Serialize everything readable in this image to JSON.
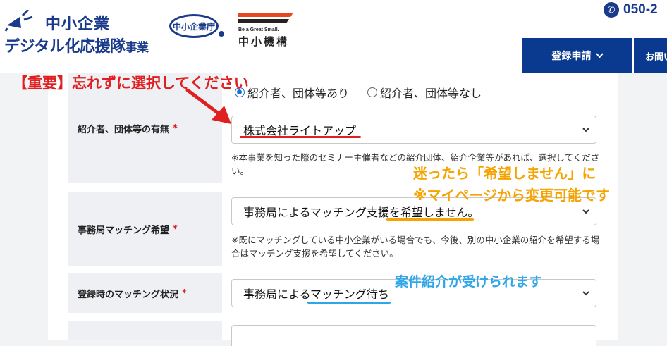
{
  "header": {
    "logo_line1": "中小企業",
    "logo_line2": "デジタル化応援隊",
    "logo_suffix": "事業",
    "agency_logo": "中小企業庁",
    "smrj_tagline": "Be a Great Small.",
    "smrj_name": "中小機構",
    "phone": "050-2",
    "nav_register": "登録申請",
    "nav_contact": "お問い"
  },
  "form": {
    "referrer": {
      "label": "紹介者、団体等の有無",
      "required": "*",
      "radio_yes": "紹介者、団体等あり",
      "radio_no": "紹介者、団体等なし",
      "selected": "株式会社ライトアップ",
      "note": "※本事業を知った際のセミナー主催者などの紹介団体、紹介企業等があれば、選択してください。"
    },
    "matching_request": {
      "label": "事務局マッチング希望",
      "required": "*",
      "selected": "事務局によるマッチング支援を希望しません。",
      "note": "※既にマッチングしている中小企業がいる場合でも、今後、別の中小企業の紹介を希望する場合はマッチング支援を希望してください。"
    },
    "matching_status": {
      "label": "登録時のマッチング状況",
      "required": "*",
      "selected": "事務局によるマッチング待ち"
    }
  },
  "annotations": {
    "important": "【重要】忘れずに選択してください",
    "orange_line1": "迷ったら「希望しません」に",
    "orange_line2": "※マイページから変更可能です",
    "blue": "案件紹介が受けられます"
  },
  "colors": {
    "brand_blue": "#1a3b8c",
    "nav_blue": "#0a3a8f",
    "annotation_red": "#e02020",
    "annotation_orange": "#f5a300",
    "annotation_blue": "#2ea7e8",
    "required_red": "#dd2222"
  }
}
